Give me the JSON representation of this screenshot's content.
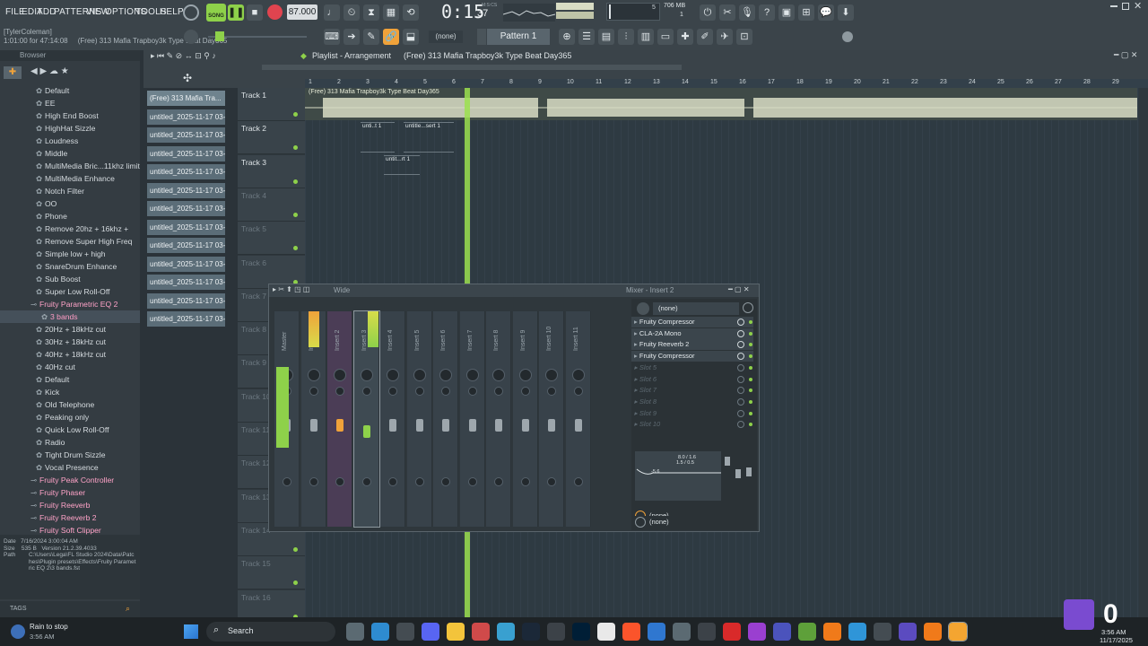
{
  "menu": [
    "FILE",
    "EDIT",
    "ADD",
    "PATTERNS",
    "VIEW",
    "OPTIONS",
    "TOOLS",
    "HELP"
  ],
  "song_mode": "SONG",
  "tempo": "87.000",
  "time": "0:15",
  "time_sub": "37",
  "time_units": "M:S:CS",
  "cpu": "5",
  "memory": "706 MB",
  "poly": "1",
  "user": "[TylerColeman]",
  "hint_line": "1:01:00 for 47:14:08",
  "hint_song": "(Free) 313 Mafia  Trapboy3k Type Beat Day365",
  "pattern": "Pattern 1",
  "none_label": "(none)",
  "browser_title": "Browser",
  "browser_items": [
    "Default",
    "EE",
    "High End Boost",
    "HighHat Sizzle",
    "Loudness",
    "Middle",
    "MultiMedia Bric...11khz limit",
    "MultiMedia Enhance",
    "Notch Filter",
    "OO",
    "Phone",
    "Remove 20hz + 16khz +",
    "Remove Super High Freq",
    "Simple low + high",
    "SnareDrum Enhance",
    "Sub Boost",
    "Super Low Roll-Off"
  ],
  "browser_plugin": "Fruity Parametric EQ 2",
  "browser_sel": "3 bands",
  "browser_items2": [
    "20Hz + 18kHz cut",
    "30Hz + 18kHz cut",
    "40Hz + 18kHz cut",
    "40Hz cut",
    "Default",
    "Kick",
    "Old Telephone",
    "Peaking only",
    "Quick Low Roll-Off",
    "Radio",
    "Tight Drum Sizzle",
    "Vocal Presence"
  ],
  "browser_plugins2": [
    "Fruity Peak Controller",
    "Fruity Phaser",
    "Fruity Reeverb",
    "Fruity Reeverb 2",
    "Fruity Soft Clipper"
  ],
  "info": {
    "date_label": "Date",
    "date": "7/16/2024 3:00:04 AM",
    "size_label": "Size",
    "size": "535 B",
    "version": "Version 21.2.39.4033",
    "path_label": "Path",
    "path": "C:\\Users\\Lega\\FL Studio 2024\\Data\\Patches\\Plugin presets\\Effects\\Fruity Parametric EQ 2\\3 bands.fst"
  },
  "tags_label": "TAGS",
  "playlist_title": "Playlist - Arrangement",
  "playlist_song": "(Free) 313 Mafia  Trapboy3k Type Beat Day365",
  "patterns": [
    "(Free) 313 Mafia Tra...",
    "untitled_2025-11-17 03-...",
    "untitled_2025-11-17 03-...",
    "untitled_2025-11-17 03-...",
    "untitled_2025-11-17 03-...",
    "untitled_2025-11-17 03-...",
    "untitled_2025-11-17 03-...",
    "untitled_2025-11-17 03-...",
    "untitled_2025-11-17 03-...",
    "untitled_2025-11-17 03-...",
    "untitled_2025-11-17 03-...",
    "untitled_2025-11-17 03-...",
    "untitled_2025-11-17 03-..."
  ],
  "tracks": [
    "Track 1",
    "Track 2",
    "Track 3",
    "Track 4",
    "Track 5",
    "Track 6",
    "Track 7",
    "Track 8",
    "Track 9",
    "Track 10",
    "Track 11",
    "Track 12",
    "Track 13",
    "Track 14",
    "Track 15",
    "Track 16"
  ],
  "ruler": [
    "1",
    "2",
    "3",
    "4",
    "5",
    "6",
    "7",
    "8",
    "9",
    "10",
    "11",
    "12",
    "13",
    "14",
    "15",
    "16",
    "17",
    "18",
    "19",
    "20",
    "21",
    "22",
    "23",
    "24",
    "25",
    "26",
    "27",
    "28",
    "29"
  ],
  "clip_audio": "(Free) 313 Mafia  Trapboy3k Type Beat Day365",
  "clip_a": "unti..t 1",
  "clip_b": "untitle...sert 1",
  "clip_c": "untit...rt 1",
  "mixer_title": "Mixer - Insert 2",
  "mixer_mode": "Wide",
  "mixer_channels": [
    "Master",
    "Insert 1",
    "Insert 2",
    "Insert 3",
    "Insert 4",
    "Insert 5",
    "Insert 6",
    "Insert 7",
    "Insert 8",
    "Insert 9",
    "Insert 10",
    "Insert 11"
  ],
  "mixer_nums": [
    "C",
    "M",
    "1",
    "2",
    "3",
    "4",
    "5",
    "6",
    "7",
    "8",
    "9",
    "10",
    "11"
  ],
  "slots": [
    "Fruity Compressor",
    "CLA-2A Mono",
    "Fruity Reeverb 2",
    "Fruity Compressor"
  ],
  "empty_slots": [
    "Slot 5",
    "Slot 6",
    "Slot 7",
    "Slot 8",
    "Slot 9",
    "Slot 10"
  ],
  "eq_readout_1": "8.0 / 1.6",
  "eq_readout_2": "1.5 / 0.5",
  "eq_small": "-5.6",
  "taskbar": {
    "weather_1": "Rain to stop",
    "weather_2": "3:56 AM",
    "search": "Search",
    "time": "3:56 AM",
    "date": "11/17/2025",
    "overlay": "0"
  },
  "colors": {
    "accent_green": "#8ed14a",
    "waveform": "#d8dcc4",
    "playhead": "#9be04f"
  }
}
